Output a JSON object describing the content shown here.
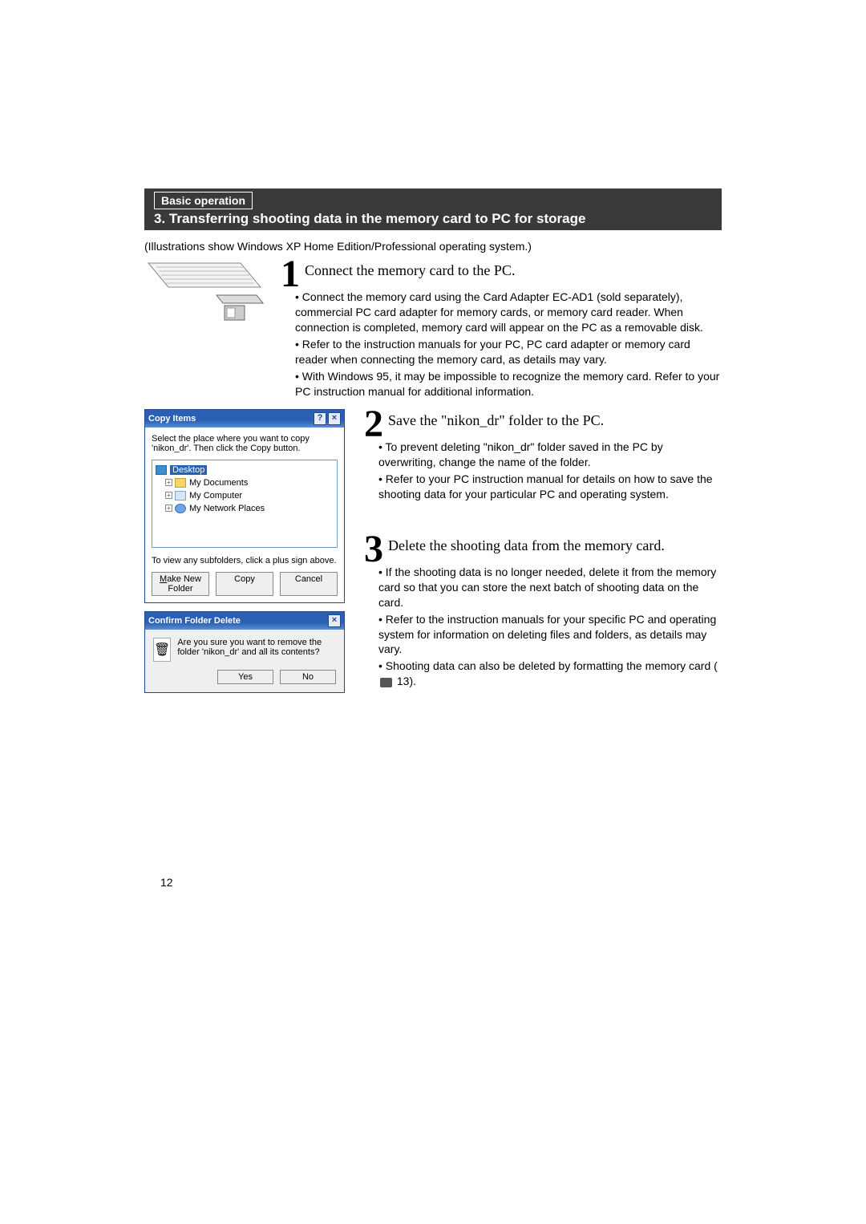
{
  "header": {
    "category": "Basic operation",
    "title": "3. Transferring shooting data in the memory card to PC for storage"
  },
  "intro": "(Illustrations show Windows XP Home Edition/Professional operating system.)",
  "step1": {
    "num": "1",
    "title": "Connect the memory card to the PC.",
    "bullets": [
      "Connect the memory card using the Card Adapter EC-AD1 (sold separately), commercial PC card adapter for memory cards, or memory card reader. When connection is completed, memory card will appear on the PC as a removable disk.",
      "Refer to the instruction manuals for your PC, PC card adapter or memory card reader when connecting the memory card, as details may vary.",
      "With Windows 95, it may be impossible to recognize the memory card. Refer to your PC instruction manual for additional information."
    ]
  },
  "step2": {
    "num": "2",
    "title": "Save the \"nikon_dr\" folder to the PC.",
    "bullets": [
      "To prevent deleting \"nikon_dr\" folder saved in the PC by overwriting, change the name of the folder.",
      "Refer to your PC instruction manual for details on how to save the shooting data for your particular PC and operating system."
    ]
  },
  "step3": {
    "num": "3",
    "title": "Delete the shooting data from the memory card.",
    "bullets": [
      "If the shooting data is no longer needed, delete it from the memory card so that you can store the next batch of shooting data on the card.",
      "Refer to the instruction manuals for your specific PC and operating system for information on deleting files and folders, as details may vary.",
      "Shooting data can also be deleted by formatting the memory card ( 📷 13)."
    ]
  },
  "copy_dialog": {
    "title": "Copy Items",
    "instruction": "Select the place where you want to copy 'nikon_dr'. Then click the Copy button.",
    "tree": {
      "desktop": "Desktop",
      "docs": "My Documents",
      "computer": "My Computer",
      "network": "My Network Places"
    },
    "subtext": "To view any subfolders, click a plus sign above.",
    "make_new": "Make New Folder",
    "copy": "Copy",
    "cancel": "Cancel"
  },
  "confirm_dialog": {
    "title": "Confirm Folder Delete",
    "message": "Are you sure you want to remove the folder 'nikon_dr' and all its contents?",
    "yes": "Yes",
    "no": "No"
  },
  "page_number": "12"
}
